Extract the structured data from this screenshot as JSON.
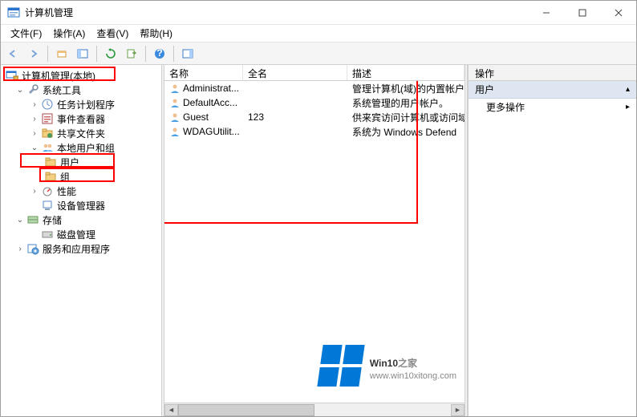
{
  "titlebar": {
    "title": "计算机管理"
  },
  "menubar": [
    {
      "label": "文件(F)"
    },
    {
      "label": "操作(A)"
    },
    {
      "label": "查看(V)"
    },
    {
      "label": "帮助(H)"
    }
  ],
  "tree": {
    "root": "计算机管理(本地)",
    "nodes": [
      {
        "label": "系统工具",
        "children": [
          {
            "label": "任务计划程序"
          },
          {
            "label": "事件查看器"
          },
          {
            "label": "共享文件夹"
          },
          {
            "label": "本地用户和组",
            "children": [
              {
                "label": "用户"
              },
              {
                "label": "组"
              }
            ]
          },
          {
            "label": "性能"
          },
          {
            "label": "设备管理器"
          }
        ]
      },
      {
        "label": "存储",
        "children": [
          {
            "label": "磁盘管理"
          }
        ]
      },
      {
        "label": "服务和应用程序"
      }
    ]
  },
  "list": {
    "columns": {
      "name": "名称",
      "full": "全名",
      "desc": "描述"
    },
    "rows": [
      {
        "name": "Administrat...",
        "full": "",
        "desc": "管理计算机(域)的内置帐户"
      },
      {
        "name": "DefaultAcc...",
        "full": "",
        "desc": "系统管理的用户帐户。"
      },
      {
        "name": "Guest",
        "full": "123",
        "desc": "供来宾访问计算机或访问域"
      },
      {
        "name": "WDAGUtilit...",
        "full": "",
        "desc": "系统为 Windows Defend"
      }
    ]
  },
  "actions": {
    "header": "操作",
    "section": "用户",
    "more": "更多操作"
  },
  "watermark": {
    "brand": "Win10",
    "suffix": "之家",
    "url": "www.win10xitong.com"
  }
}
